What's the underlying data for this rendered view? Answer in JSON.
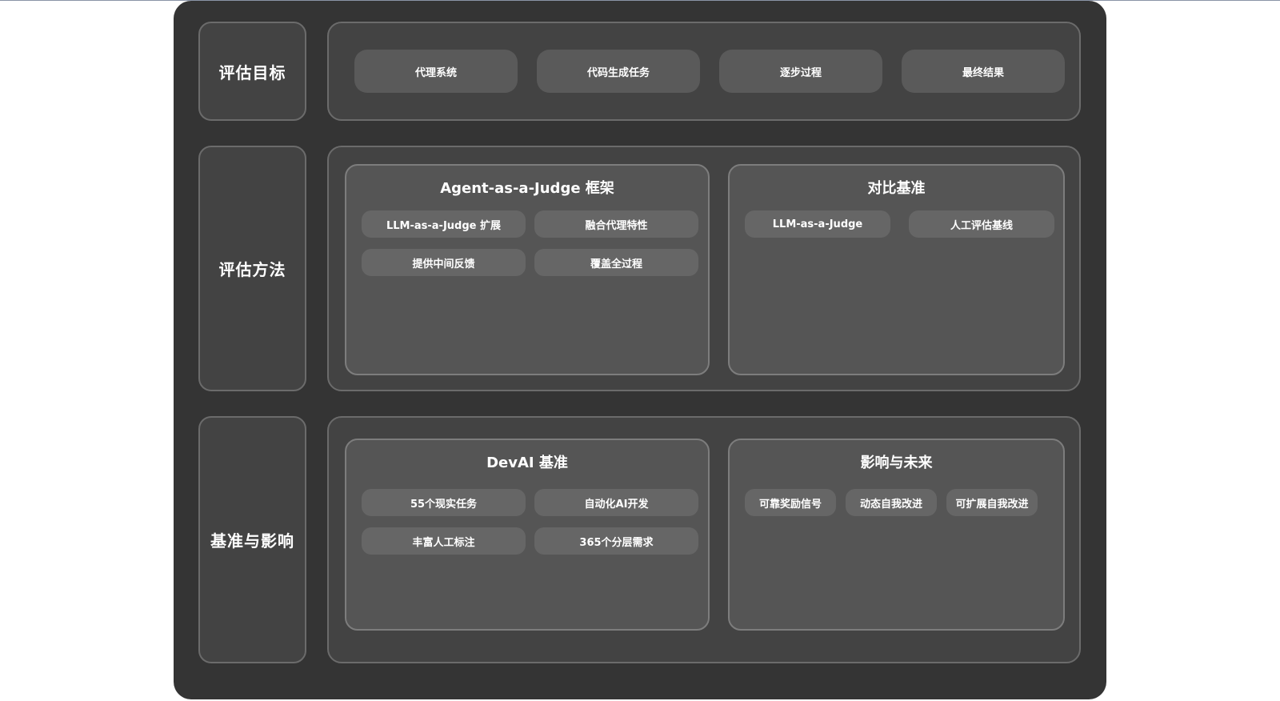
{
  "rows": {
    "goals": {
      "label": "评估目标",
      "items": [
        "代理系统",
        "代码生成任务",
        "逐步过程",
        "最终结果"
      ]
    },
    "methods": {
      "label": "评估方法",
      "framework": {
        "title": "Agent-as-a-Judge 框架",
        "items": [
          "LLM-as-a-Judge 扩展",
          "融合代理特性",
          "提供中间反馈",
          "覆盖全过程"
        ]
      },
      "baselines": {
        "title": "对比基准",
        "items": [
          "LLM-as-a-Judge",
          "人工评估基线"
        ]
      }
    },
    "impact": {
      "label": "基准与影响",
      "devai": {
        "title": "DevAI 基准",
        "items": [
          "55个现实任务",
          "自动化AI开发",
          "丰富人工标注",
          "365个分层需求"
        ]
      },
      "future": {
        "title": "影响与未来",
        "items": [
          "可靠奖励信号",
          "动态自我改进",
          "可扩展自我改进"
        ]
      }
    }
  },
  "colors": {
    "canvas": "#343434",
    "box": "#434343",
    "panel": "#555555",
    "chip": "#666666",
    "border": "#6b6b6b",
    "text": "#ffffff"
  }
}
